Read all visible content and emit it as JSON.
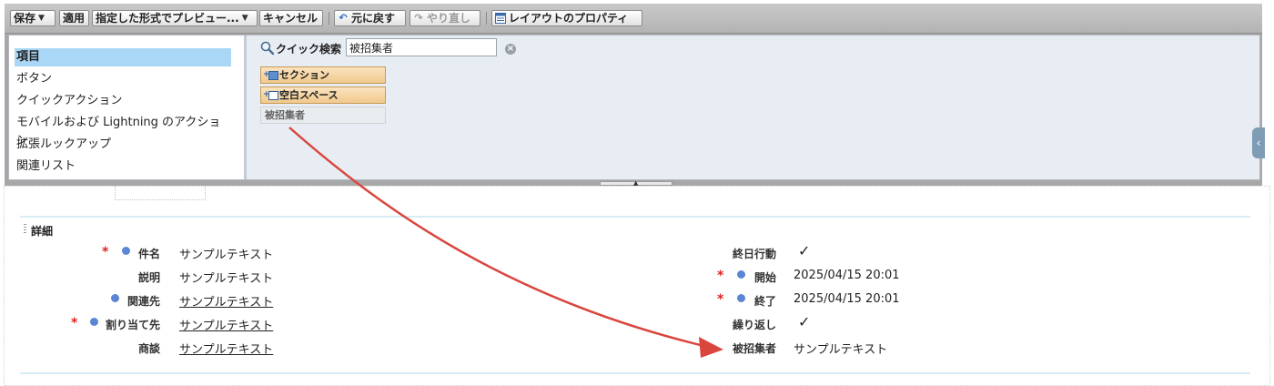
{
  "toolbar": {
    "save": "保存",
    "apply": "適用",
    "preview": "指定した形式でプレビュー...",
    "cancel": "キャンセル",
    "undo": "元に戻す",
    "redo": "やり直し",
    "layout_properties": "レイアウトのプロパティ"
  },
  "palette": {
    "categories": [
      "項目",
      "ボタン",
      "クイックアクション",
      "モバイルおよび Lightning のアクション",
      "拡張ルックアップ",
      "関連リスト"
    ],
    "active_category": "項目",
    "quick_search_label": "クイック検索",
    "quick_search_value": "被招集者",
    "items": [
      {
        "label": "セクション",
        "icon": "section-icon"
      },
      {
        "label": "空白スペース",
        "icon": "blank-space-icon"
      },
      {
        "label": "被招集者",
        "icon": ""
      }
    ]
  },
  "layout": {
    "section_title": "詳細",
    "left_fields": [
      {
        "label": "件名",
        "value": "サンプルテキスト",
        "required": true,
        "dot": true,
        "link": false
      },
      {
        "label": "説明",
        "value": "サンプルテキスト",
        "required": false,
        "dot": false,
        "link": false
      },
      {
        "label": "関連先",
        "value": "サンプルテキスト",
        "required": false,
        "dot": true,
        "link": true
      },
      {
        "label": "割り当て先",
        "value": "サンプルテキスト",
        "required": true,
        "dot": true,
        "link": true
      },
      {
        "label": "商談",
        "value": "サンプルテキスト",
        "required": false,
        "dot": false,
        "link": true
      }
    ],
    "right_fields": [
      {
        "label": "終日行動",
        "value": "✓",
        "required": false,
        "dot": false
      },
      {
        "label": "開始",
        "value": "2025/04/15 20:01",
        "required": true,
        "dot": true
      },
      {
        "label": "終了",
        "value": "2025/04/15 20:01",
        "required": true,
        "dot": true
      },
      {
        "label": "繰り返し",
        "value": "✓",
        "required": false,
        "dot": false
      },
      {
        "label": "被招集者",
        "value": "サンプルテキスト",
        "required": false,
        "dot": false
      }
    ]
  },
  "colors": {
    "arrow": "#d9463e",
    "active_category_bg": "#a9d7f5",
    "required_mark": "#e02020",
    "info_dot": "#5b86d6"
  }
}
